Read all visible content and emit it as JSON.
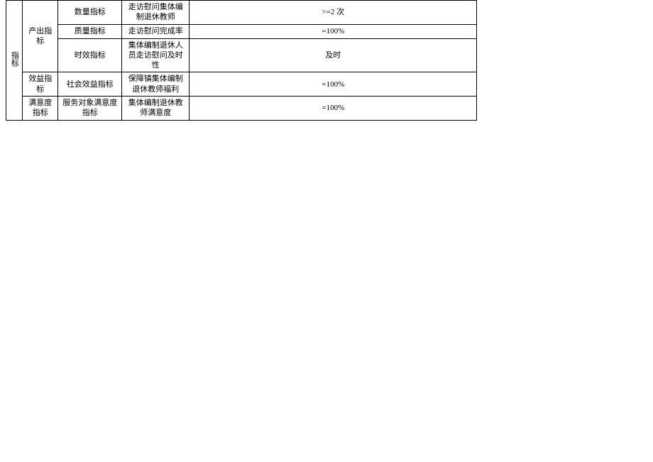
{
  "table": {
    "col1": "指标",
    "output_group": "产出指标",
    "rows": [
      {
        "level2": "数量指标",
        "level3": "走访慰问集体编制退休教师",
        "value": ">=2 次"
      },
      {
        "level2": "质量指标",
        "level3": "走访慰问完成率",
        "value": "=100%"
      },
      {
        "level2": "时效指标",
        "level3": "集体编制退休人员走访慰问及时性",
        "value": "及时"
      },
      {
        "group": "效益指标",
        "level2": "社会效益指标",
        "level3": "保障镇集体编制退休教师福利",
        "value": "=100%"
      },
      {
        "group": "满意度指标",
        "level2": "服务对象满意度指标",
        "level3": "集体编制退休教师满意度",
        "value": "=100%"
      }
    ]
  }
}
